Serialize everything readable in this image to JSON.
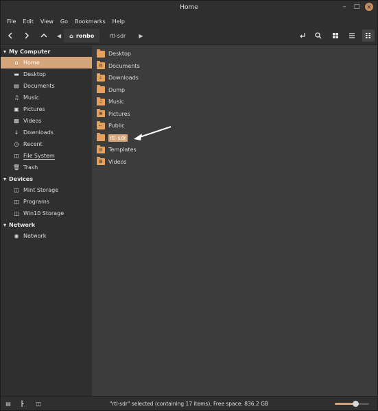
{
  "window": {
    "title": "Home"
  },
  "menu": [
    "File",
    "Edit",
    "View",
    "Go",
    "Bookmarks",
    "Help"
  ],
  "toolbar": {
    "crumbs": [
      "ronbo",
      "rtl-sdr"
    ]
  },
  "sidebar": {
    "sections": [
      {
        "title": "My Computer",
        "items": [
          "Home",
          "Desktop",
          "Documents",
          "Music",
          "Pictures",
          "Videos",
          "Downloads",
          "Recent",
          "File System",
          "Trash"
        ]
      },
      {
        "title": "Devices",
        "items": [
          "Mint Storage",
          "Programs",
          "Win10 Storage"
        ]
      },
      {
        "title": "Network",
        "items": [
          "Network"
        ]
      }
    ],
    "selected": "Home"
  },
  "files": [
    "Desktop",
    "Documents",
    "Downloads",
    "Dump",
    "Music",
    "Pictures",
    "Public",
    "rtl-sdr",
    "Templates",
    "Videos"
  ],
  "selected_file": "rtl-sdr",
  "status": {
    "text": "\"rtl-sdr\" selected (containing 17 items), Free space: 836.2 GB",
    "zoom_level": 0.6
  },
  "colors": {
    "accent": "#d4a57a",
    "folder": "#e6a15c"
  }
}
